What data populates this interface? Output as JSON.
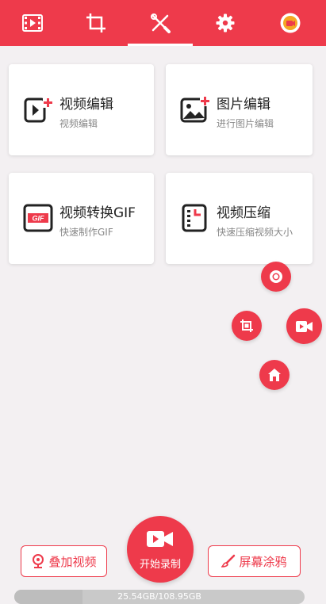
{
  "tabs": [
    {
      "name": "video-tab",
      "icon": "film-icon"
    },
    {
      "name": "crop-tab",
      "icon": "crop-icon"
    },
    {
      "name": "tools-tab",
      "icon": "tools-icon",
      "active": true
    },
    {
      "name": "settings-tab",
      "icon": "gear-icon"
    },
    {
      "name": "profile-tab",
      "icon": "avatar-icon"
    }
  ],
  "cards": [
    {
      "title": "视频编辑",
      "subtitle": "视频编辑",
      "icon": "video-edit-icon"
    },
    {
      "title": "图片编辑",
      "subtitle": "进行图片编辑",
      "icon": "image-edit-icon"
    },
    {
      "title": "视频转换GIF",
      "subtitle": "快速制作GIF",
      "icon": "gif-icon",
      "icon_text": "GIF"
    },
    {
      "title": "视频压缩",
      "subtitle": "快速压缩视频大小",
      "icon": "compress-icon"
    }
  ],
  "floating_menu": [
    "record-dot-icon",
    "screenshot-icon",
    "camera-icon",
    "home-icon"
  ],
  "bottom": {
    "overlay_label": "叠加视频",
    "record_label": "开始录制",
    "doodle_label": "屏幕涂鸦"
  },
  "storage": {
    "text": "25.54GB/108.95GB",
    "used_fraction": 0.234
  },
  "colors": {
    "accent": "#ee3a4b",
    "background": "#f3f0f2"
  }
}
